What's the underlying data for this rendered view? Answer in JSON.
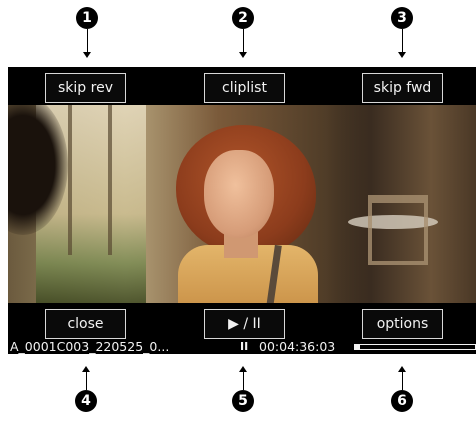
{
  "callouts": [
    "1",
    "2",
    "3",
    "4",
    "5",
    "6"
  ],
  "buttons": {
    "skip_rev": "skip rev",
    "cliplist": "cliplist",
    "skip_fwd": "skip fwd",
    "close": "close",
    "play_pause": "▶ / II",
    "options": "options"
  },
  "status": {
    "clip_name": "A_0001C003_220525_0...",
    "playback_state": "II",
    "timecode": "00:04:36:03",
    "progress": 0.04
  },
  "colors": {
    "device_background": "#000000",
    "button_border": "#d8d8d8",
    "text": "#f2f2f2"
  }
}
